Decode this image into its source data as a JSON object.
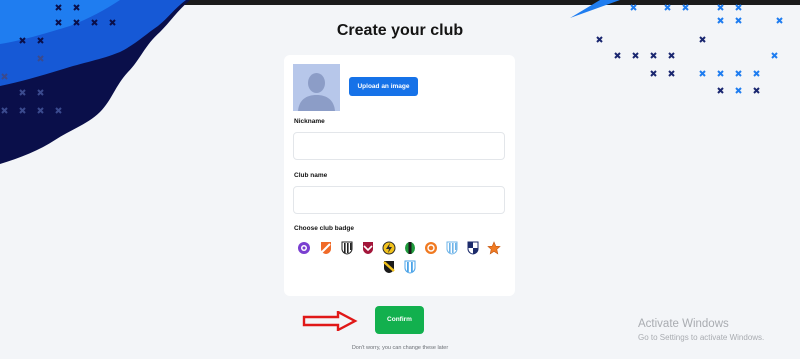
{
  "page": {
    "title": "Create your club"
  },
  "upload": {
    "button_label": "Upload an image"
  },
  "form": {
    "nickname_label": "Nickname",
    "nickname_value": "",
    "club_name_label": "Club name",
    "club_name_value": "",
    "badge_label": "Choose club badge",
    "badges": [
      {
        "name": "badge-purple-ball",
        "colors": [
          "#7a3fd0",
          "#ffffff"
        ]
      },
      {
        "name": "badge-orange-stripe",
        "colors": [
          "#f06a28",
          "#ffffff"
        ]
      },
      {
        "name": "badge-black-white-stripes",
        "colors": [
          "#222222",
          "#ffffff"
        ]
      },
      {
        "name": "badge-maroon-chevron",
        "colors": [
          "#a3163a",
          "#ffffff"
        ]
      },
      {
        "name": "badge-yellow-lightning",
        "colors": [
          "#f2c21b",
          "#2b2b2b"
        ]
      },
      {
        "name": "badge-green-black",
        "colors": [
          "#1e9b3c",
          "#1b1b1b"
        ]
      },
      {
        "name": "badge-orange-circle",
        "colors": [
          "#f07a22",
          "#ffffff"
        ]
      },
      {
        "name": "badge-sky-stripes",
        "colors": [
          "#6fb4e8",
          "#ffffff"
        ]
      },
      {
        "name": "badge-navy-quarters",
        "colors": [
          "#1c2b6b",
          "#ffffff"
        ]
      },
      {
        "name": "badge-orange-star",
        "colors": [
          "#f07a22",
          "#ffffff"
        ]
      },
      {
        "name": "badge-black-yellow-sash",
        "colors": [
          "#1b1b1b",
          "#f2c21b"
        ]
      },
      {
        "name": "badge-light-blue-stripes",
        "colors": [
          "#4aa3e8",
          "#ffffff"
        ]
      }
    ]
  },
  "actions": {
    "confirm_label": "Confirm",
    "footnote": "Don't worry, you can change these later"
  },
  "watermark": {
    "title": "Activate Windows",
    "subtitle": "Go to Settings to activate Windows."
  },
  "colors": {
    "background": "#f3f5f8",
    "primary_blue": "#1672e8",
    "confirm_green": "#12b04e",
    "deco_navy": "#0a0f4a",
    "arrow_red": "#e01818"
  }
}
